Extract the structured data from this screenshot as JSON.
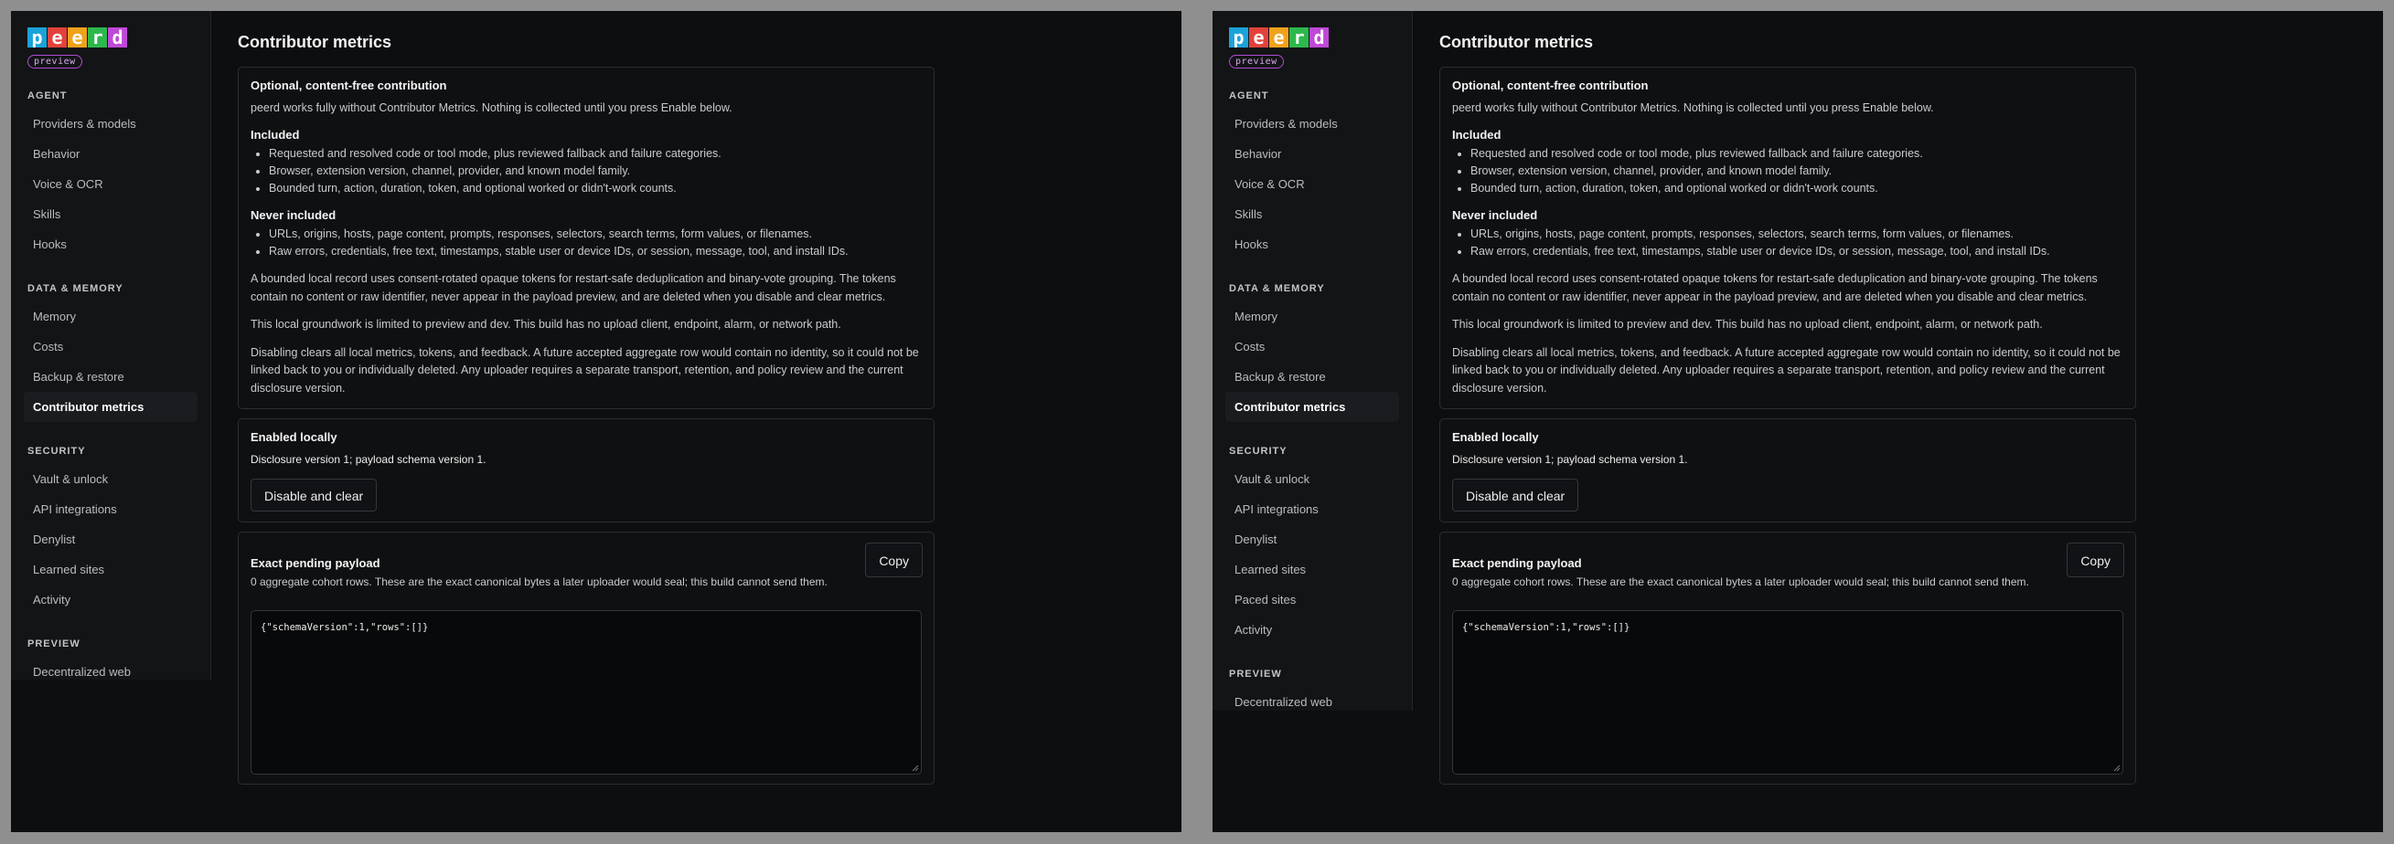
{
  "logo": {
    "letters": [
      {
        "char": "p",
        "color": "#1aa3d9"
      },
      {
        "char": "e",
        "color": "#e2423a"
      },
      {
        "char": "e",
        "color": "#f0a21a"
      },
      {
        "char": "r",
        "color": "#2db84d"
      },
      {
        "char": "d",
        "color": "#c048d8"
      }
    ],
    "badge": "preview"
  },
  "windows": [
    {
      "sidebar": {
        "sections": [
          {
            "label": "AGENT",
            "items": [
              "Providers & models",
              "Behavior",
              "Voice & OCR",
              "Skills",
              "Hooks"
            ]
          },
          {
            "label": "DATA & MEMORY",
            "items": [
              "Memory",
              "Costs",
              "Backup & restore",
              "Contributor metrics"
            ]
          },
          {
            "label": "SECURITY",
            "items": [
              "Vault & unlock",
              "API integrations",
              "Denylist",
              "Learned sites",
              "Activity"
            ]
          },
          {
            "label": "PREVIEW",
            "items": [
              "Decentralized web"
            ]
          }
        ],
        "active": "Contributor metrics"
      }
    },
    {
      "sidebar": {
        "sections": [
          {
            "label": "AGENT",
            "items": [
              "Providers & models",
              "Behavior",
              "Voice & OCR",
              "Skills",
              "Hooks"
            ]
          },
          {
            "label": "DATA & MEMORY",
            "items": [
              "Memory",
              "Costs",
              "Backup & restore",
              "Contributor metrics"
            ]
          },
          {
            "label": "SECURITY",
            "items": [
              "Vault & unlock",
              "API integrations",
              "Denylist",
              "Learned sites",
              "Paced sites",
              "Activity"
            ]
          },
          {
            "label": "PREVIEW",
            "items": [
              "Decentralized web"
            ]
          }
        ],
        "active": "Contributor metrics"
      }
    }
  ],
  "page": {
    "title": "Contributor metrics",
    "intro_card": {
      "title": "Optional, content-free contribution",
      "intro": "peerd works fully without Contributor Metrics. Nothing is collected until you press Enable below.",
      "included_title": "Included",
      "included": [
        "Requested and resolved code or tool mode, plus reviewed fallback and failure categories.",
        "Browser, extension version, channel, provider, and known model family.",
        "Bounded turn, action, duration, token, and optional worked or didn't-work counts."
      ],
      "never_title": "Never included",
      "never": [
        "URLs, origins, hosts, page content, prompts, responses, selectors, search terms, form values, or filenames.",
        "Raw errors, credentials, free text, timestamps, stable user or device IDs, or session, message, tool, and install IDs."
      ],
      "para1": "A bounded local record uses consent-rotated opaque tokens for restart-safe deduplication and binary-vote grouping. The tokens contain no content or raw identifier, never appear in the payload preview, and are deleted when you disable and clear metrics.",
      "para2": "This local groundwork is limited to preview and dev. This build has no upload client, endpoint, alarm, or network path.",
      "para3": "Disabling clears all local metrics, tokens, and feedback. A future accepted aggregate row would contain no identity, so it could not be linked back to you or individually deleted. Any uploader requires a separate transport, retention, and policy review and the current disclosure version."
    },
    "status_card": {
      "title": "Enabled locally",
      "detail": "Disclosure version 1; payload schema version 1.",
      "button": "Disable and clear"
    },
    "payload_card": {
      "title": "Exact pending payload",
      "description": "0 aggregate cohort rows. These are the exact canonical bytes a later uploader would seal; this build cannot send them.",
      "copy_button": "Copy",
      "payload": "{\"schemaVersion\":1,\"rows\":[]}"
    }
  }
}
